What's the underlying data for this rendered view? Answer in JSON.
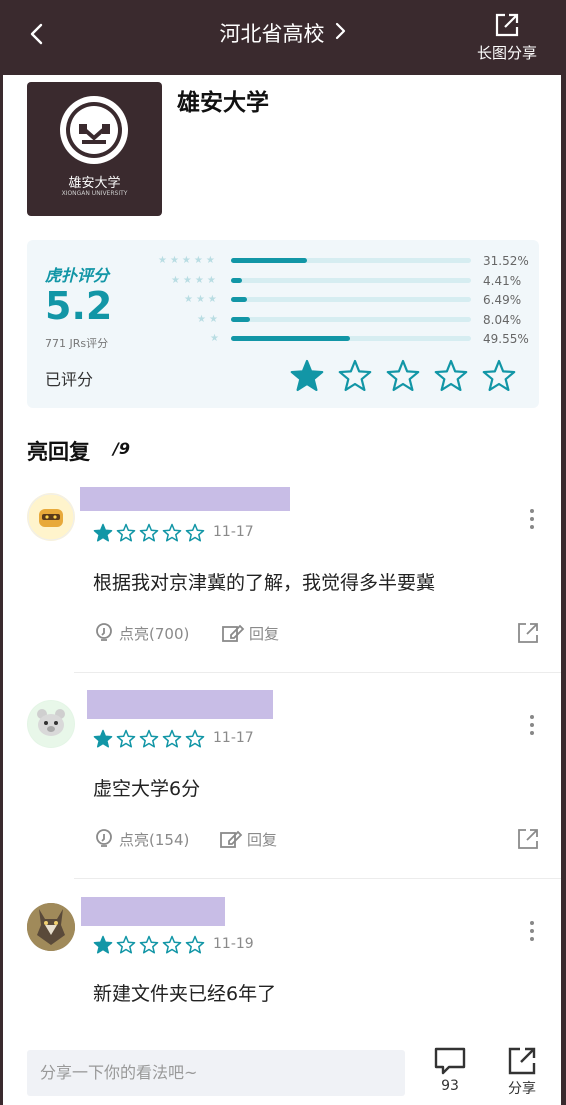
{
  "header": {
    "title": "河北省高校",
    "share_label": "长图分享"
  },
  "school": {
    "name": "雄安大学",
    "logo_text": "雄安大学",
    "logo_subtext": "XIONGAN UNIVERSITY"
  },
  "rating": {
    "label": "虎扑评分",
    "score": "5.2",
    "count_text": "771 JRs评分",
    "rated_text": "已评分",
    "user_rating_stars": 1,
    "distribution": [
      {
        "stars": 5,
        "percent_text": "31.52%",
        "fraction": 0.3152
      },
      {
        "stars": 4,
        "percent_text": "4.41%",
        "fraction": 0.0441
      },
      {
        "stars": 3,
        "percent_text": "6.49%",
        "fraction": 0.0649
      },
      {
        "stars": 2,
        "percent_text": "8.04%",
        "fraction": 0.0804
      },
      {
        "stars": 1,
        "percent_text": "49.55%",
        "fraction": 0.4955
      }
    ]
  },
  "replies": {
    "title": "亮回复",
    "count": "/9",
    "items": [
      {
        "stars": 1,
        "date": "11-17",
        "text": "根据我对京津冀的了解，我觉得多半要冀",
        "like_label": "点亮(700)",
        "reply_label": "回复",
        "avatar": "robot-avatar"
      },
      {
        "stars": 1,
        "date": "11-17",
        "text": "虚空大学6分",
        "like_label": "点亮(154)",
        "reply_label": "回复",
        "avatar": "bear-avatar"
      },
      {
        "stars": 1,
        "date": "11-19",
        "text": "新建文件夹已经6年了",
        "avatar": "wolf-avatar"
      }
    ]
  },
  "bottom": {
    "placeholder": "分享一下你的看法吧~",
    "comment_count": "93",
    "share_label": "分享"
  },
  "colors": {
    "accent": "#1296a6",
    "header_bg": "#3a2a2e",
    "username_redaction": "#c8bde6"
  }
}
